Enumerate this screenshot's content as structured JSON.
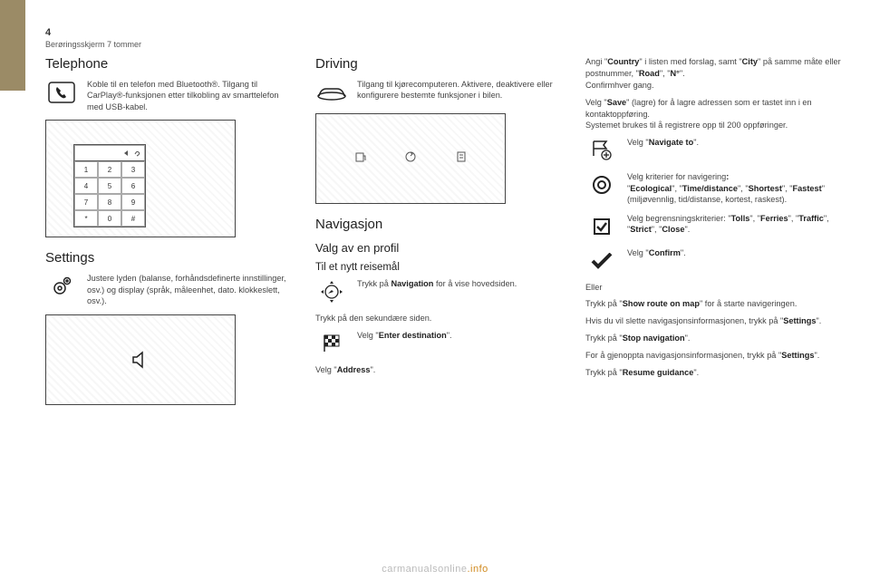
{
  "page_number": "4",
  "breadcrumb": "Berøringsskjerm 7 tommer",
  "footer": {
    "left": "carmanualsonline",
    "right": ".info"
  },
  "col1": {
    "telephone": {
      "title": "Telephone",
      "desc": "Koble til en telefon med Bluetooth®. Tilgang til CarPlay®-funksjonen etter tilkobling av smarttelefon med USB-kabel.",
      "keypad": {
        "rows": [
          [
            "1",
            "2",
            "3"
          ],
          [
            "4",
            "5",
            "6"
          ],
          [
            "7",
            "8",
            "9"
          ],
          [
            "*",
            "0",
            "#"
          ]
        ]
      }
    },
    "settings": {
      "title": "Settings",
      "desc": "Justere lyden (balanse, forhåndsdefinerte innstillinger, osv.) og display (språk, måleenhet, dato. klokkeslett, osv.)."
    }
  },
  "col2": {
    "driving": {
      "title": "Driving",
      "desc": "Tilgang til kjørecomputeren. Aktivere, deaktivere eller konfigurere bestemte funksjoner i bilen."
    },
    "nav": {
      "title": "Navigasjon",
      "subtitle": "Valg av en profil",
      "subsub": "Til et nytt reisemål",
      "nav_press_pre": "Trykk på ",
      "nav_press_bold": "Navigation",
      "nav_press_post": " for å vise hovedsiden.",
      "secondary": "Trykk på den sekundære siden.",
      "enter_dest_pre": "Velg \"",
      "enter_dest_bold": "Enter destination",
      "enter_dest_post": "\".",
      "address_pre": "Velg \"",
      "address_bold": "Address",
      "address_post": "\"."
    }
  },
  "col3": {
    "p1_a": "Angi \"",
    "p1_b": "Country",
    "p1_c": "\" i listen med forslag, samt \"",
    "p1_d": "City",
    "p1_e": "\" på samme måte eller postnummer, \"",
    "p1_f": "Road",
    "p1_g": "\", \"",
    "p1_h": "N°",
    "p1_i": "\".",
    "p1_j": "Confirmhver gang.",
    "p2_a": "Velg \"",
    "p2_b": "Save",
    "p2_c": "\" (lagre) for å lagre adressen som er tastet inn i en kontaktoppføring.",
    "p2_d": "Systemet brukes til å registrere opp til 200 oppføringer.",
    "r1_a": "Velg \"",
    "r1_b": "Navigate to",
    "r1_c": "\".",
    "r2_a": "Velg kriterier for navigering",
    "r2_b": ":",
    "r2_c": "\"",
    "r2_d": "Ecological",
    "r2_e": "\", \"",
    "r2_f": "Time/distance",
    "r2_g": "\", \"",
    "r2_h": "Shortest",
    "r2_i": "\", \"",
    "r2_j": "Fastest",
    "r2_k": "\" (miljøvennlig, tid/distanse, kortest, raskest).",
    "r3_a": "Velg begrensningskriterier: \"",
    "r3_b": "Tolls",
    "r3_c": "\", \"",
    "r3_d": "Ferries",
    "r3_e": "\", \"",
    "r3_f": "Traffic",
    "r3_g": "\", \"",
    "r3_h": "Strict",
    "r3_i": "\", \"",
    "r3_j": "Close",
    "r3_k": "\".",
    "r4_a": "Velg \"",
    "r4_b": "Confirm",
    "r4_c": "\".",
    "p3": "Eller",
    "p4_a": "Trykk på \"",
    "p4_b": "Show route on map",
    "p4_c": "\" for å starte navigeringen.",
    "p5_a": "Hvis du vil slette navigasjonsinformasjonen, trykk på \"",
    "p5_b": "Settings",
    "p5_c": "\".",
    "p6_a": "Trykk på \"",
    "p6_b": "Stop navigation",
    "p6_c": "\".",
    "p7_a": "For å gjenoppta navigasjonsinformasjonen, trykk på \"",
    "p7_b": "Settings",
    "p7_c": "\".",
    "p8_a": "Trykk på \"",
    "p8_b": "Resume guidance",
    "p8_c": "\"."
  }
}
